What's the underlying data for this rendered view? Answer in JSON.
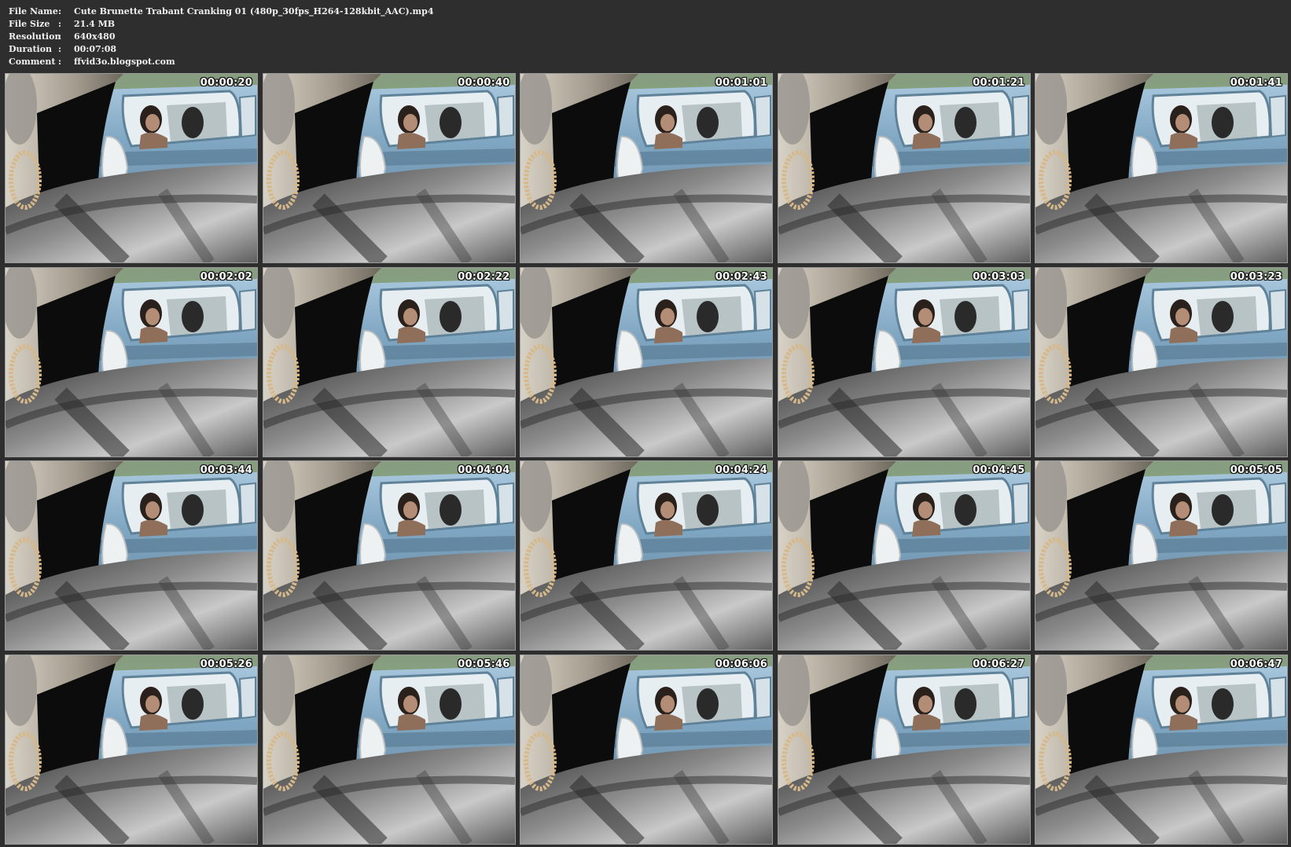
{
  "info": [
    {
      "label": "File Name",
      "sep": ":",
      "value": "Cute Brunette Trabant Cranking 01 (480p_30fps_H264-128kbit_AAC).mp4"
    },
    {
      "label": "File Size",
      "sep": ":",
      "value": "21.4 MB"
    },
    {
      "label": "Resolution",
      "sep": ":",
      "value": "640x480"
    },
    {
      "label": "Duration",
      "sep": ":",
      "value": "00:07:08"
    },
    {
      "label": "Comment",
      "sep": ":",
      "value": "ffvid3o.blogspot.com"
    }
  ],
  "thumbnails": [
    {
      "timestamp": "00:00:20"
    },
    {
      "timestamp": "00:00:40"
    },
    {
      "timestamp": "00:01:01"
    },
    {
      "timestamp": "00:01:21"
    },
    {
      "timestamp": "00:01:41"
    },
    {
      "timestamp": "00:02:02"
    },
    {
      "timestamp": "00:02:22"
    },
    {
      "timestamp": "00:02:43"
    },
    {
      "timestamp": "00:03:03"
    },
    {
      "timestamp": "00:03:23"
    },
    {
      "timestamp": "00:03:44"
    },
    {
      "timestamp": "00:04:04"
    },
    {
      "timestamp": "00:04:24"
    },
    {
      "timestamp": "00:04:45"
    },
    {
      "timestamp": "00:05:05"
    },
    {
      "timestamp": "00:05:26"
    },
    {
      "timestamp": "00:05:46"
    },
    {
      "timestamp": "00:06:06"
    },
    {
      "timestamp": "00:06:27"
    },
    {
      "timestamp": "00:06:47"
    }
  ],
  "colors": {
    "background": "#2e2e2e",
    "text": "#f0f0f0",
    "car_blue": "#8fb3c9",
    "dashboard": "#5a5a5a"
  }
}
